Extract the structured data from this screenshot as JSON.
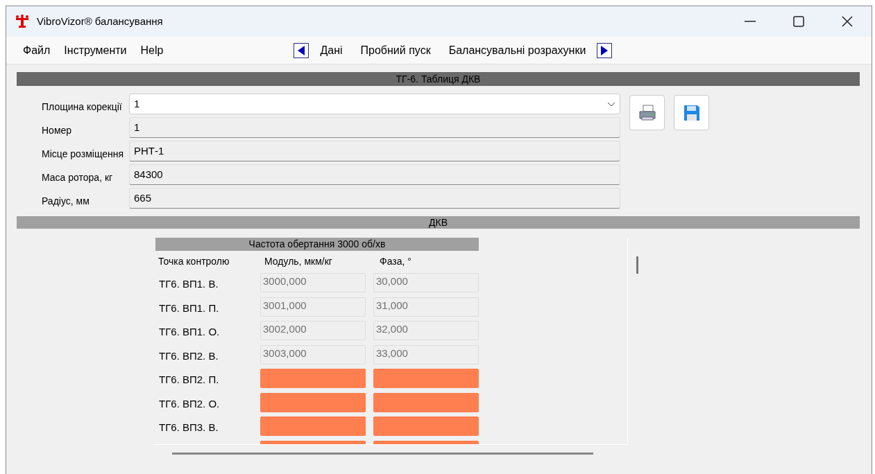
{
  "window": {
    "title": "VibroVizor® балансування"
  },
  "menu": [
    {
      "label": "Файл"
    },
    {
      "label": "Інструменти"
    },
    {
      "label": "Help"
    }
  ],
  "nav": {
    "items": [
      {
        "label": "Дані"
      },
      {
        "label": "Пробний пуск"
      },
      {
        "label": "Балансувальні розрахунки"
      }
    ]
  },
  "section_title": "ТГ-6. Таблиця ДКВ",
  "form": [
    {
      "label": "Площина корекції",
      "value": "1",
      "kind": "dropdown"
    },
    {
      "label": "Номер",
      "value": "1",
      "kind": "text"
    },
    {
      "label": "Місце розміщення",
      "value": "РНТ-1",
      "kind": "text"
    },
    {
      "label": "Маса ротора, кг",
      "value": "84300",
      "kind": "text"
    },
    {
      "label": "Радіус, мм",
      "value": "665",
      "kind": "text"
    }
  ],
  "dkv_title": "ДКВ",
  "table": {
    "title": "Частота обертання 3000 об/хв",
    "columns": [
      "Точка контролю",
      "Модуль, мкм/кг",
      "Фаза, °"
    ],
    "rows": [
      {
        "point": "ТГ6. ВП1. В.",
        "module": "3000,000",
        "phase": "30,000",
        "missing": false
      },
      {
        "point": "ТГ6. ВП1. П.",
        "module": "3001,000",
        "phase": "31,000",
        "missing": false
      },
      {
        "point": "ТГ6. ВП1. О.",
        "module": "3002,000",
        "phase": "32,000",
        "missing": false
      },
      {
        "point": "ТГ6. ВП2. В.",
        "module": "3003,000",
        "phase": "33,000",
        "missing": false
      },
      {
        "point": "ТГ6. ВП2. П.",
        "missing": true
      },
      {
        "point": "ТГ6. ВП2. О.",
        "missing": true
      },
      {
        "point": "ТГ6. ВП3. В.",
        "missing": true
      },
      {
        "missing": true
      }
    ]
  }
}
